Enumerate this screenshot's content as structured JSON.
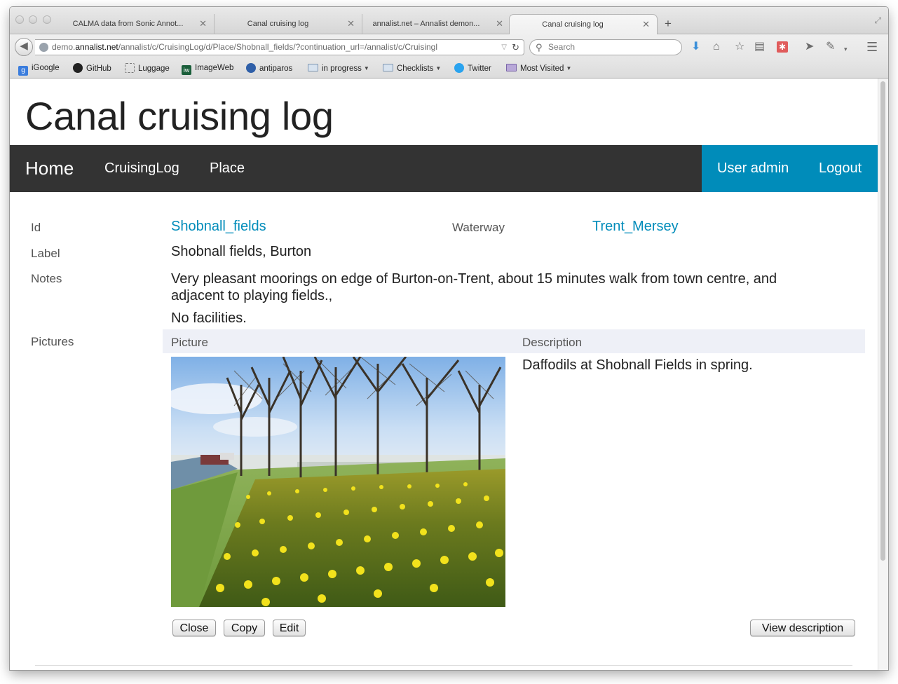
{
  "browser": {
    "tabs": [
      {
        "title": "CALMA data from Sonic Annot...",
        "active": false
      },
      {
        "title": "Canal cruising log",
        "active": false
      },
      {
        "title": "annalist.net – Annalist demon...",
        "active": false
      },
      {
        "title": "Canal cruising log",
        "active": true
      }
    ],
    "url_prefix": "demo.",
    "url_domain": "annalist.net",
    "url_path": "/annalist/c/CruisingLog/d/Place/Shobnall_fields/?continuation_url=/annalist/c/Cruisingl",
    "search_placeholder": "Search",
    "bookmarks": [
      {
        "label": "iGoogle",
        "icon": "google-icon"
      },
      {
        "label": "GitHub",
        "icon": "github-icon"
      },
      {
        "label": "Luggage",
        "icon": "luggage-icon"
      },
      {
        "label": "ImageWeb",
        "icon": "imageweb-icon"
      },
      {
        "label": "antiparos",
        "icon": "antiparos-icon"
      },
      {
        "label": "in progress",
        "icon": "folder-icon"
      },
      {
        "label": "Checklists",
        "icon": "folder-icon"
      },
      {
        "label": "Twitter",
        "icon": "twitter-icon"
      },
      {
        "label": "Most Visited",
        "icon": "most-visited-icon"
      }
    ]
  },
  "site": {
    "title": "Canal cruising log",
    "nav": {
      "home": "Home",
      "items": [
        "CruisingLog",
        "Place"
      ],
      "user_admin": "User admin",
      "logout": "Logout"
    }
  },
  "record": {
    "id_label": "Id",
    "id_value": "Shobnall_fields",
    "waterway_label": "Waterway",
    "waterway_value": "Trent_Mersey",
    "label_label": "Label",
    "label_value": "Shobnall fields, Burton",
    "notes_label": "Notes",
    "notes_line1": "Very pleasant moorings on edge of Burton-on-Trent, about 15 minutes walk from town centre, and",
    "notes_line2": "adjacent to playing fields.,",
    "notes_line3": "No facilities.",
    "pictures_label": "Pictures",
    "pictures_columns": [
      "Picture",
      "Description"
    ],
    "pictures": [
      {
        "description": "Daffodils at Shobnall Fields in spring."
      }
    ]
  },
  "buttons": {
    "close": "Close",
    "copy": "Copy",
    "edit": "Edit",
    "view_description": "View description"
  },
  "colors": {
    "nav_bg": "#333333",
    "accent": "#008cba",
    "table_header_bg": "#eef0f7"
  }
}
